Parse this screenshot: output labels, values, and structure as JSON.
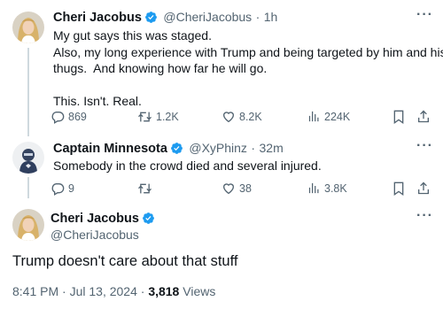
{
  "tweet1": {
    "author_name": "Cheri Jacobus",
    "handle": "@CheriJacobus",
    "separator": "·",
    "time": "1h",
    "lines": [
      "My gut says this was staged.",
      "Also, my long experience with Trump and being targeted by him and his",
      "thugs.  And knowing how far he will go.",
      "",
      "This. Isn't. Real."
    ],
    "actions": {
      "replies": "869",
      "reposts": "1.2K",
      "likes": "8.2K",
      "views": "224K"
    }
  },
  "tweet2": {
    "author_name": "Captain Minnesota",
    "handle": "@XyPhinz",
    "separator": "·",
    "time": "32m",
    "lines": [
      "Somebody in the crowd died and several injured."
    ],
    "actions": {
      "replies": "9",
      "reposts": "",
      "likes": "38",
      "views": "3.8K"
    }
  },
  "main": {
    "author_name": "Cheri Jacobus",
    "handle": "@CheriJacobus",
    "text": "Trump doesn't care about that stuff",
    "timestamp": "8:41 PM · Jul 13, 2024 · ",
    "views_count": "3,818",
    "views_label": " Views"
  },
  "colors": {
    "verified_blue": "#1d9bf0",
    "muted": "#536471",
    "text": "#0f1419",
    "thread": "#cfd9de"
  },
  "icons": [
    "verified-badge-icon",
    "more-icon",
    "reply-icon",
    "repost-icon",
    "like-icon",
    "views-icon",
    "bookmark-icon",
    "share-icon"
  ]
}
